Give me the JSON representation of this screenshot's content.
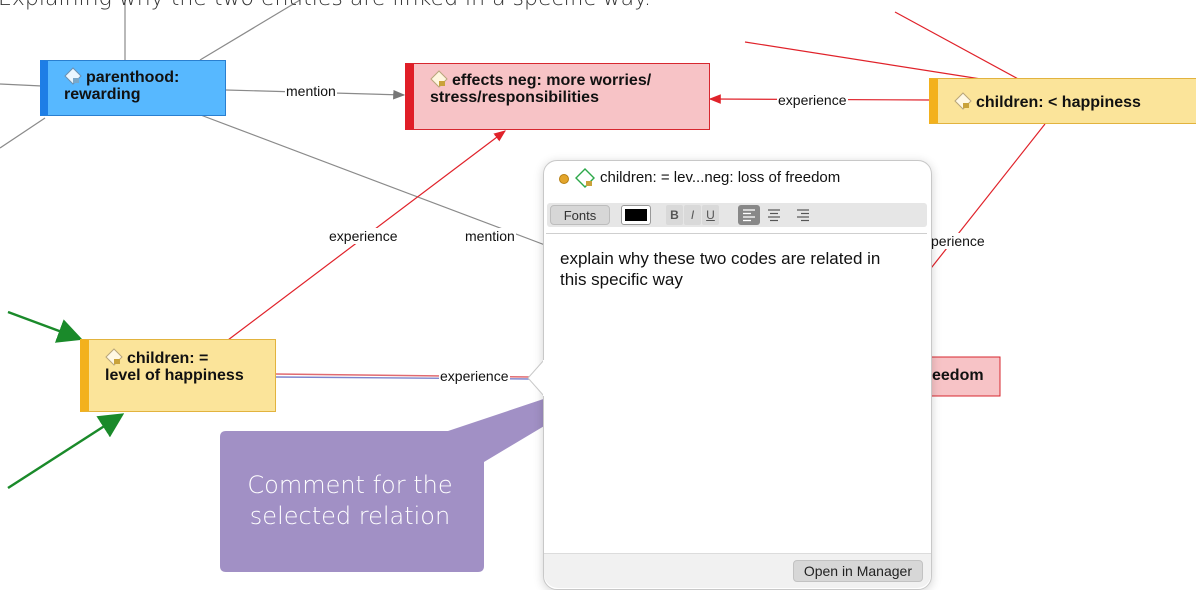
{
  "caption": "Explaining why the two entities are linked in a specific way.",
  "nodes": {
    "parenthood_line1": "parenthood:",
    "parenthood_line2": "rewarding",
    "effects_line1": "effects neg: more worries/",
    "effects_line2": "stress/responsibilities",
    "happiness_less": "children: < happiness",
    "equal_line1": "children: =",
    "equal_line2": "level of happiness",
    "freedom_fragment": "eedom"
  },
  "edges": {
    "mention_top": "mention",
    "experience_top": "experience",
    "experience_left": "experience",
    "mention_mid": "mention",
    "experience_right": "perience",
    "experience_bottom": "experience"
  },
  "popup": {
    "title": "children: = lev...neg: loss of freedom",
    "toolbar": {
      "fonts": "Fonts",
      "bold": "B",
      "italic": "I",
      "underline": "U"
    },
    "memo": "explain why these two codes are related in this specific way",
    "open_button": "Open in Manager"
  },
  "callout": "Comment for the selected relation",
  "colors": {
    "blue_node": "#57b8ff",
    "red_node": "#f7c3c6",
    "yellow_node": "#fbe49a",
    "callout": "#a190c5",
    "green_arrow": "#1a8a2a"
  }
}
